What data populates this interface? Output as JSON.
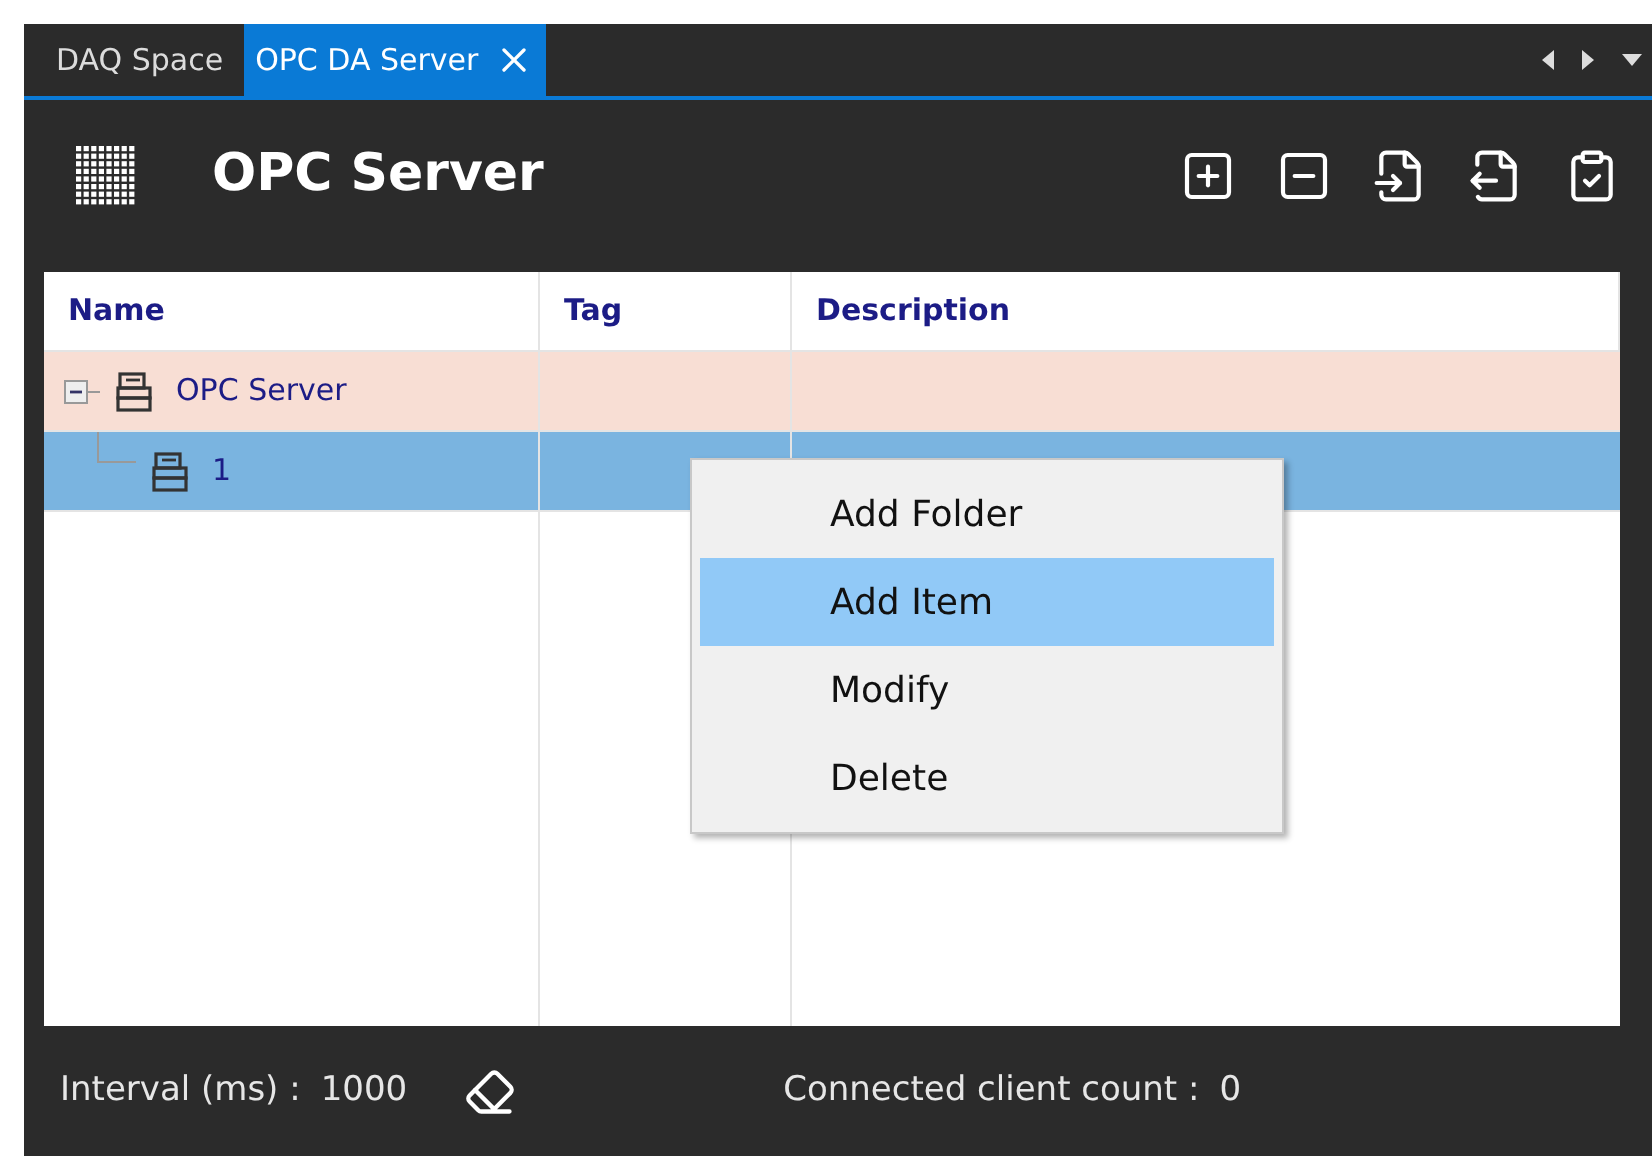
{
  "tabs": [
    {
      "label": "DAQ Space",
      "selected": false,
      "closable": false
    },
    {
      "label": "OPC DA Server",
      "selected": true,
      "closable": true
    }
  ],
  "panel": {
    "title": "OPC Server"
  },
  "table": {
    "columns": [
      "Name",
      "Tag",
      "Description"
    ],
    "rows": [
      {
        "name": "OPC Server",
        "highlighted": true,
        "selected": false,
        "expanded": true,
        "children": [
          {
            "name": "1",
            "selected": true
          }
        ]
      }
    ]
  },
  "context_menu": {
    "items": [
      {
        "label": "Add Folder",
        "selected": false
      },
      {
        "label": "Add Item",
        "selected": true
      },
      {
        "label": "Modify",
        "selected": false
      },
      {
        "label": "Delete",
        "selected": false
      }
    ]
  },
  "status_bar": {
    "interval_label": "Interval (ms) :",
    "interval_value": "1000",
    "client_label": "Connected client count :",
    "client_value": "0"
  }
}
